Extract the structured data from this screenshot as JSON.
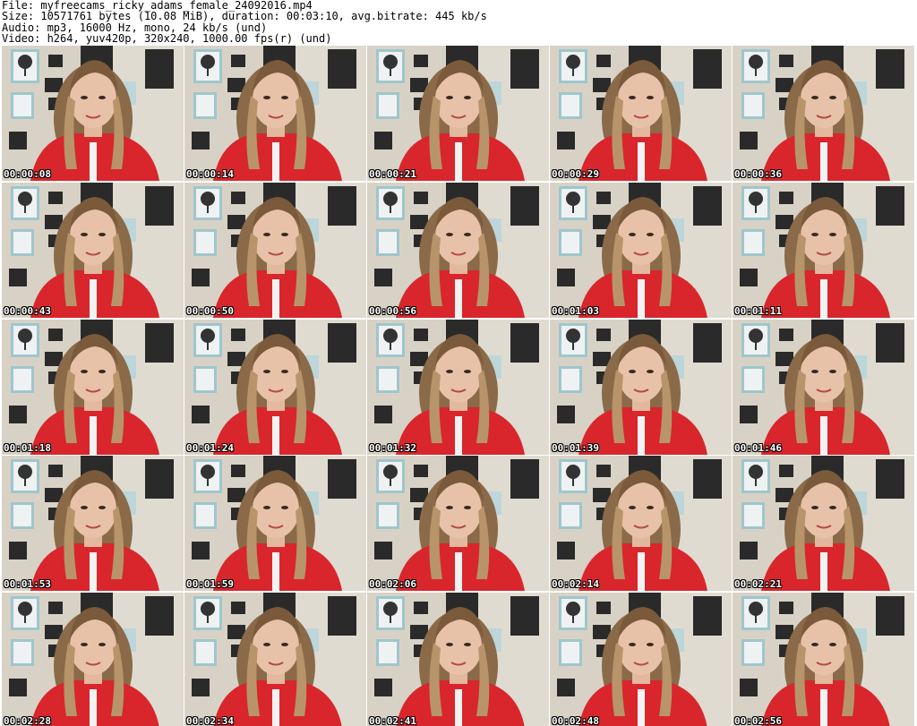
{
  "header": {
    "file": "File: myfreecams_ricky_adams_female_24092016.mp4",
    "size": "Size: 10571761 bytes (10.08 MiB), duration: 00:03:10, avg.bitrate: 445 kb/s",
    "audio": "Audio: mp3, 16000 Hz, mono, 24 kb/s (und)",
    "video": "Video: h264, yuv420p, 320x240, 1000.00 fps(r) (und)"
  },
  "thumbnails": [
    {
      "timestamp": "00:00:08"
    },
    {
      "timestamp": "00:00:14"
    },
    {
      "timestamp": "00:00:21"
    },
    {
      "timestamp": "00:00:29"
    },
    {
      "timestamp": "00:00:36"
    },
    {
      "timestamp": "00:00:43"
    },
    {
      "timestamp": "00:00:50"
    },
    {
      "timestamp": "00:00:56"
    },
    {
      "timestamp": "00:01:03"
    },
    {
      "timestamp": "00:01:11"
    },
    {
      "timestamp": "00:01:18"
    },
    {
      "timestamp": "00:01:24"
    },
    {
      "timestamp": "00:01:32"
    },
    {
      "timestamp": "00:01:39"
    },
    {
      "timestamp": "00:01:46"
    },
    {
      "timestamp": "00:01:53"
    },
    {
      "timestamp": "00:01:59"
    },
    {
      "timestamp": "00:02:06"
    },
    {
      "timestamp": "00:02:14"
    },
    {
      "timestamp": "00:02:21"
    },
    {
      "timestamp": "00:02:28"
    },
    {
      "timestamp": "00:02:34"
    },
    {
      "timestamp": "00:02:41"
    },
    {
      "timestamp": "00:02:48"
    },
    {
      "timestamp": "00:02:56"
    }
  ],
  "colors": {
    "wall": "#d8d2c6",
    "shirt": "#d8262c",
    "hair": "#8a6a48",
    "skin": "#e8c2a8",
    "poster_frame": "#9fc6cc",
    "dark_frame": "#2a2a2a",
    "timestamp_text": "#ffffff"
  }
}
